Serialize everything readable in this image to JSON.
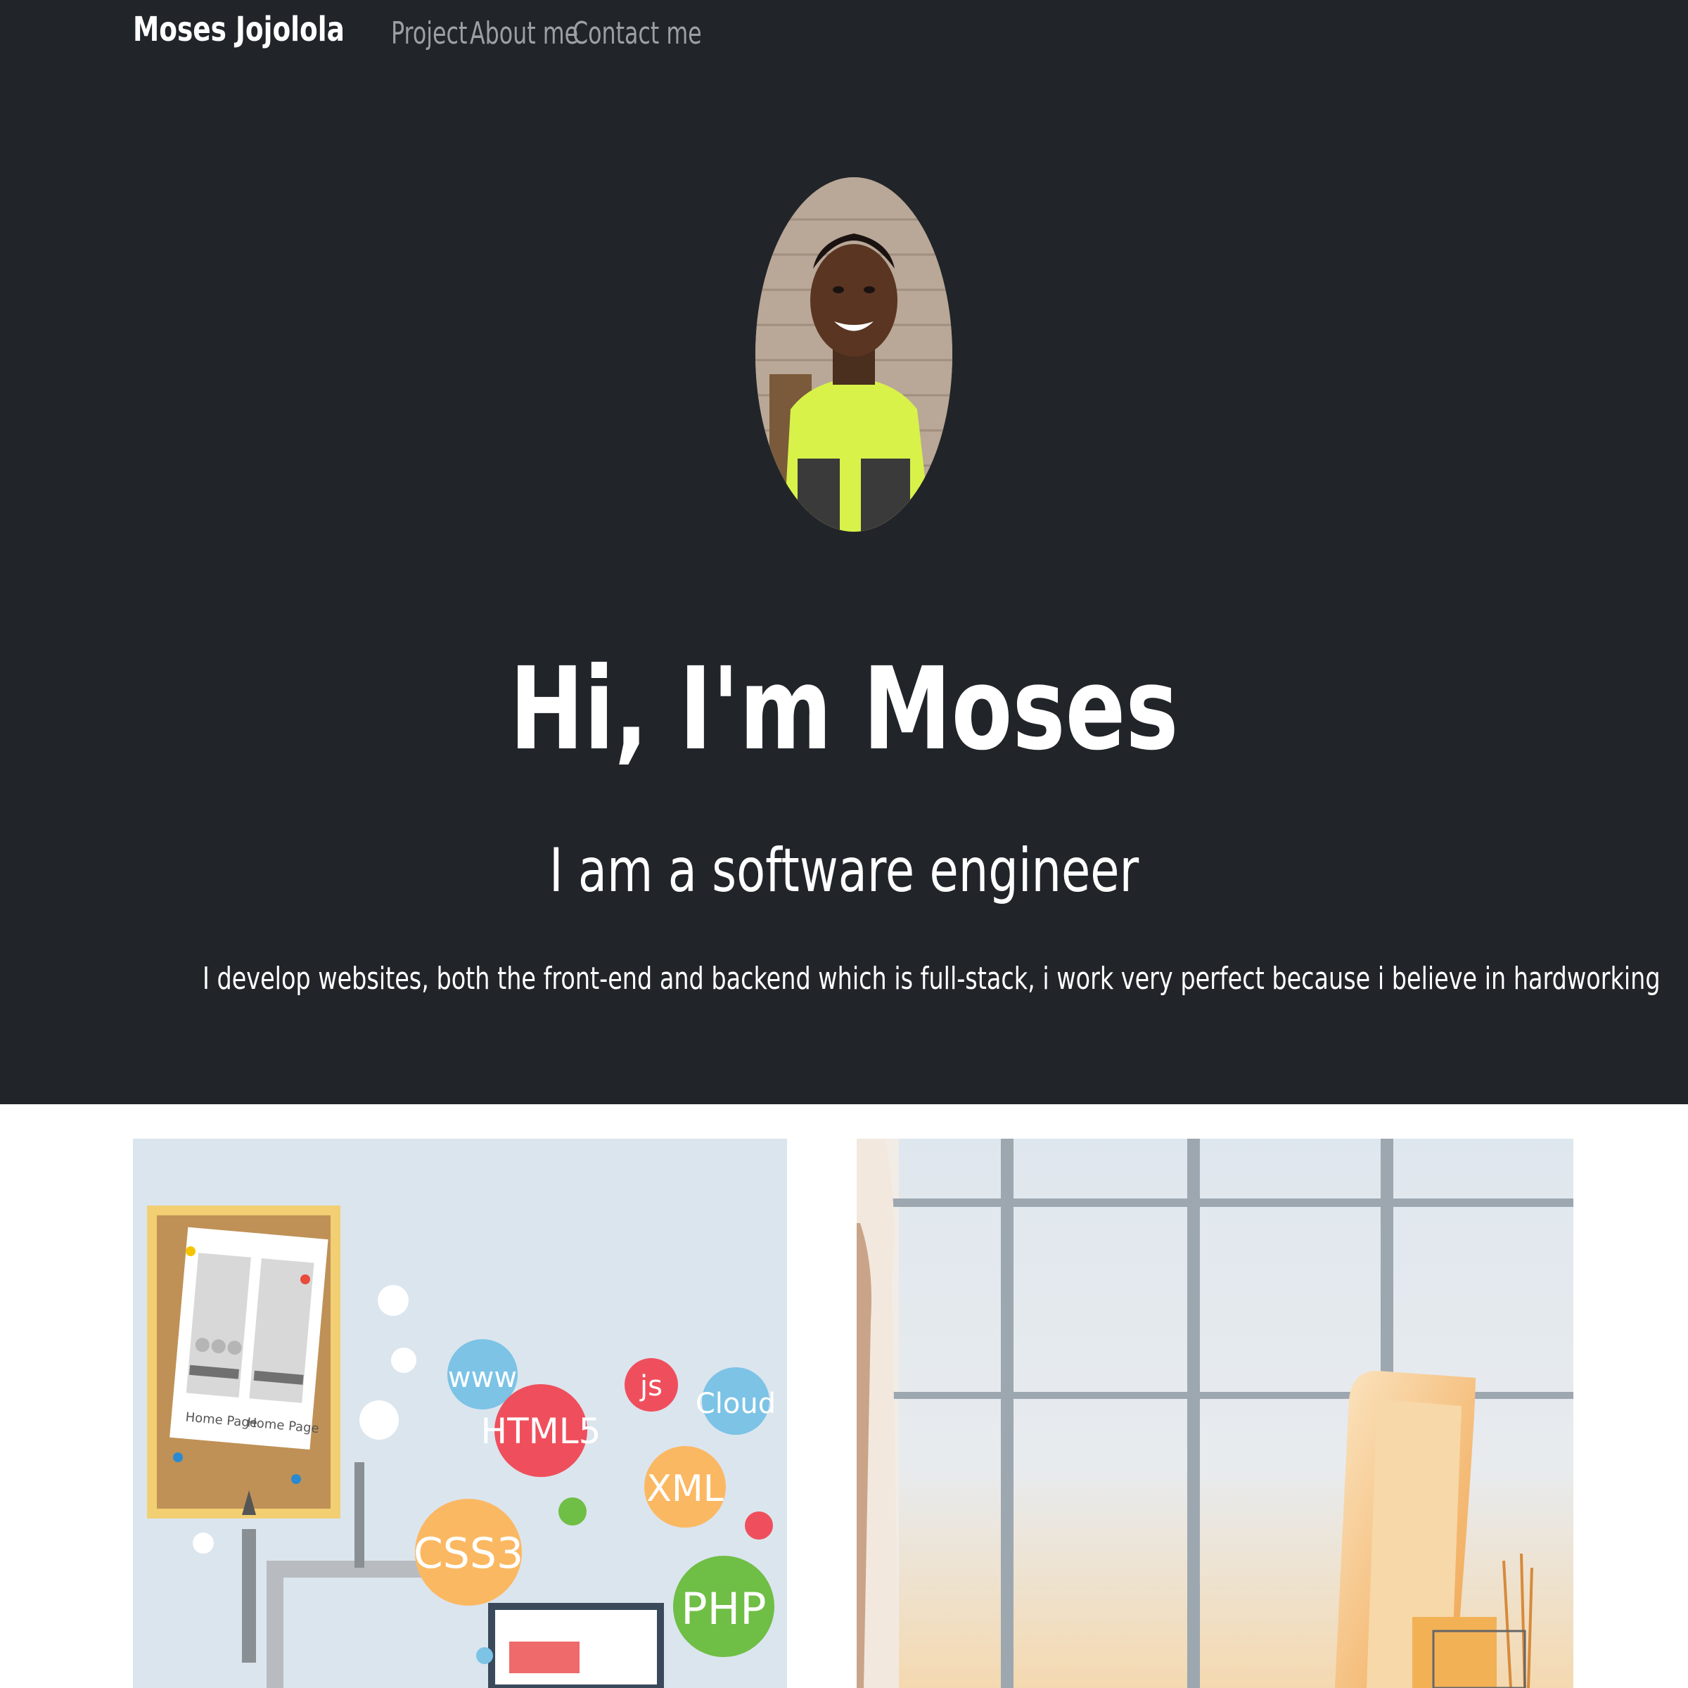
{
  "nav": {
    "brand": "Moses Jojolola",
    "links": [
      "Project",
      "About me",
      "Contact me"
    ]
  },
  "hero": {
    "title": "Hi, I'm Moses",
    "subtitle": "I am a software engineer",
    "description": "I develop websites, both the front-end and backend which is full-stack, i work very perfect because i believe in hardworking"
  },
  "projects": {
    "card1": {
      "bubbles": [
        "www",
        "HTML5",
        "js",
        "Cloud",
        "XML",
        "CSS3",
        "PHP"
      ],
      "page_labels": [
        "Home Page",
        "Home Page"
      ]
    }
  },
  "colors": {
    "hero_bg": "#212529",
    "nav_link": "#9ba0a6",
    "bubble_blue": "#7cc3e6",
    "bubble_red": "#ef4f5c",
    "bubble_orange": "#fbb862",
    "bubble_green": "#6fbe45"
  }
}
